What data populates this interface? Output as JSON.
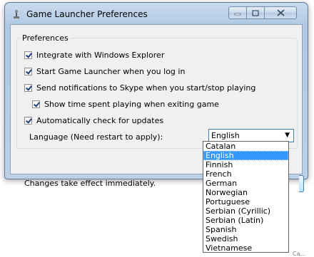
{
  "window": {
    "title": "Game Launcher Preferences",
    "icon": "joystick-icon",
    "controls": [
      "minimize-icon",
      "maximize-icon",
      "close-icon"
    ]
  },
  "preferences": {
    "group_label": "Preferences",
    "checkboxes": [
      {
        "label": "Integrate with Windows Explorer",
        "checked": true
      },
      {
        "label": "Start Game Launcher when you log in",
        "checked": true
      },
      {
        "label": "Send notifications to Skype when you start/stop playing",
        "checked": true
      },
      {
        "label": "Show time spent playing when exiting game",
        "checked": true
      },
      {
        "label": "Automatically check for updates",
        "checked": true
      }
    ],
    "language_label": "Language (Need restart to apply):",
    "language_value": "English"
  },
  "footer": {
    "text": "Changes take effect immediately."
  },
  "language_options": [
    "Catalan",
    "English",
    "Finnish",
    "French",
    "German",
    "Norwegian",
    "Portuguese",
    "Serbian (Cyrillic)",
    "Serbian (Latin)",
    "Spanish",
    "Swedish",
    "Vietnamese"
  ],
  "selected_language": "English",
  "edge_text": "Ca..."
}
